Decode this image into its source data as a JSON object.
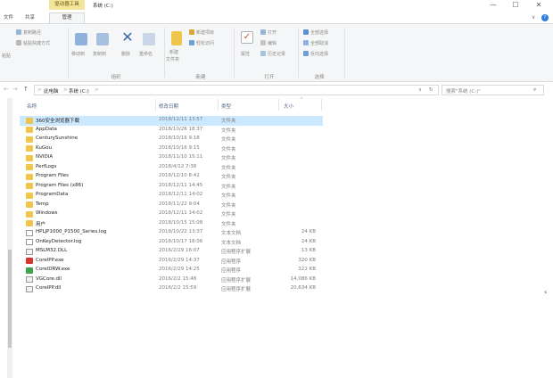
{
  "window": {
    "context_tab": "驱动器工具",
    "title": "系统 (C:)",
    "minimize": "—",
    "maximize": "☐",
    "close": "✕"
  },
  "ribbon_tabs": {
    "file": "文件",
    "share": "共享",
    "manage": "管理",
    "collapse": "∨",
    "help": "?"
  },
  "ribbon": {
    "clip_copy_path": "复制路径",
    "clip_paste_shortcut": "粘贴快捷方式",
    "clip_paste": "粘贴",
    "move_to": "移动到",
    "copy_to": "复制到",
    "delete": "删除",
    "rename": "重命名",
    "new_item": "新建项目",
    "easy_access": "轻松访问",
    "new_folder_1": "新建",
    "new_folder_2": "文件夹",
    "properties": "属性",
    "open": "打开",
    "edit": "编辑",
    "history": "历史记录",
    "select_all": "全部选择",
    "select_none": "全部取消",
    "invert_selection": "反向选择",
    "group_organize": "组织",
    "group_new": "新建",
    "group_open": "打开",
    "group_select": "选择"
  },
  "address": {
    "back": "←",
    "forward": "→",
    "up": "↑",
    "crumb_pc": "此电脑",
    "crumb_drive": "系统 (C:)",
    "sep": ">",
    "dropdown": "∨",
    "refresh": "↻",
    "search_placeholder": "搜索\"系统 (C:)\"",
    "search_icon": "⌕"
  },
  "columns": {
    "name": "名称",
    "date": "修改日期",
    "type": "类型",
    "size": "大小",
    "sort_indicator": "^"
  },
  "files": [
    {
      "name": "360安全浏览器下载",
      "date": "2018/12/11 13:57",
      "type": "文件夹",
      "size": "",
      "icon": "folder-icon",
      "selected": true
    },
    {
      "name": "AppData",
      "date": "2018/10/26 18:37",
      "type": "文件夹",
      "size": "",
      "icon": "folder-icon"
    },
    {
      "name": "CenturySunshine",
      "date": "2018/10/16 9:18",
      "type": "文件夹",
      "size": "",
      "icon": "folder-icon"
    },
    {
      "name": "KuGou",
      "date": "2018/10/16 9:15",
      "type": "文件夹",
      "size": "",
      "icon": "folder-icon"
    },
    {
      "name": "NVIDIA",
      "date": "2018/11/10 15:11",
      "type": "文件夹",
      "size": "",
      "icon": "folder-icon"
    },
    {
      "name": "PerfLogs",
      "date": "2018/4/12 7:38",
      "type": "文件夹",
      "size": "",
      "icon": "folder-icon"
    },
    {
      "name": "Program Files",
      "date": "2018/12/10 8:42",
      "type": "文件夹",
      "size": "",
      "icon": "folder-icon"
    },
    {
      "name": "Program Files (x86)",
      "date": "2018/12/11 14:45",
      "type": "文件夹",
      "size": "",
      "icon": "folder-icon"
    },
    {
      "name": "ProgramData",
      "date": "2018/12/11 14:02",
      "type": "文件夹",
      "size": "",
      "icon": "folder-icon"
    },
    {
      "name": "Temp",
      "date": "2018/11/22 9:04",
      "type": "文件夹",
      "size": "",
      "icon": "folder-icon"
    },
    {
      "name": "Windows",
      "date": "2018/12/11 14:02",
      "type": "文件夹",
      "size": "",
      "icon": "folder-icon"
    },
    {
      "name": "用户",
      "date": "2018/10/15 15:08",
      "type": "文件夹",
      "size": "",
      "icon": "folder-icon"
    },
    {
      "name": "HPLJP1000_P1500_Series.log",
      "date": "2018/10/22 13:37",
      "type": "文本文档",
      "size": "24 KB",
      "icon": "text-file-icon"
    },
    {
      "name": "OnKeyDetector.log",
      "date": "2018/10/17 18:06",
      "type": "文本文档",
      "size": "24 KB",
      "icon": "text-file-icon"
    },
    {
      "name": "MSLM32.DLL",
      "date": "2016/2/29 16:07",
      "type": "应用程序扩展",
      "size": "13 KB",
      "icon": "dll-file-icon"
    },
    {
      "name": "CorelPP.exe",
      "date": "2016/2/29 14:37",
      "type": "应用程序",
      "size": "320 KB",
      "icon": "corel-pp-icon"
    },
    {
      "name": "CorelDRW.exe",
      "date": "2016/2/29 14:25",
      "type": "应用程序",
      "size": "322 KB",
      "icon": "corel-draw-icon"
    },
    {
      "name": "VGCore.dll",
      "date": "2016/2/2 15:48",
      "type": "应用程序扩展",
      "size": "14,086 KB",
      "icon": "dll-file-icon"
    },
    {
      "name": "CorelPP.dll",
      "date": "2016/2/2 15:59",
      "type": "应用程序扩展",
      "size": "20,634 KB",
      "icon": "dll-file-icon"
    }
  ],
  "right_scroll": "‹",
  "colors": {
    "accent": "#2f7de1",
    "selection": "#cce8ff",
    "folder": "#f0c64a",
    "context_tab": "#f3e59a"
  }
}
